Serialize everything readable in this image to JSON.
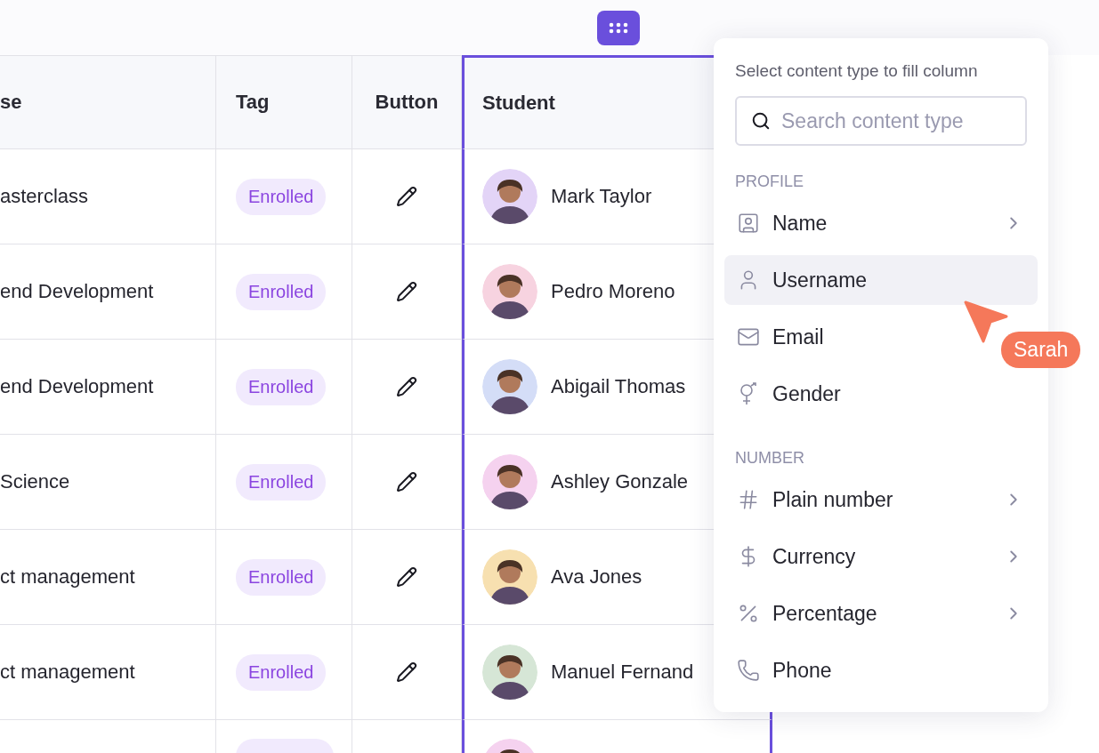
{
  "table": {
    "columns": [
      {
        "label": "se"
      },
      {
        "label": "Tag"
      },
      {
        "label": "Button"
      },
      {
        "label": "Student",
        "selected": true
      }
    ],
    "rows": [
      {
        "kind": "full",
        "course": "asterclass",
        "tag": "Enrolled",
        "student": "Mark Taylor",
        "color": "#e3d4f7"
      },
      {
        "kind": "full",
        "course": "end Development",
        "tag": "Enrolled",
        "student": "Pedro Moreno",
        "color": "#f7d3e0"
      },
      {
        "kind": "full",
        "course": "end Development",
        "tag": "Enrolled",
        "student": "Abigail Thomas",
        "color": "#d4ddf7"
      },
      {
        "kind": "full",
        "course": "Science",
        "tag": "Enrolled",
        "student": "Ashley Gonzale",
        "color": "#f5d2ef"
      },
      {
        "kind": "full",
        "course": "ct management",
        "tag": "Enrolled",
        "student": "Ava Jones",
        "color": "#f7e0b0"
      },
      {
        "kind": "full",
        "course": "ct management",
        "tag": "Enrolled",
        "student": "Manuel Fernand",
        "color": "#d6e6d6"
      },
      {
        "kind": "partial",
        "color": "#f5d2ef"
      }
    ]
  },
  "menu": {
    "title": "Select content type to fill column",
    "search": {
      "placeholder": "Search content type"
    },
    "sections": [
      {
        "label": "PROFILE",
        "items": [
          {
            "label": "Name",
            "has_submenu": true,
            "selected": false
          },
          {
            "label": "Username",
            "has_submenu": false,
            "selected": true
          },
          {
            "label": "Email",
            "has_submenu": false,
            "selected": false
          },
          {
            "label": "Gender",
            "has_submenu": false,
            "selected": false
          }
        ]
      },
      {
        "label": "NUMBER",
        "items": [
          {
            "label": "Plain number",
            "has_submenu": true,
            "selected": false
          },
          {
            "label": "Currency",
            "has_submenu": true,
            "selected": false
          },
          {
            "label": "Percentage",
            "has_submenu": true,
            "selected": false
          },
          {
            "label": "Phone",
            "has_submenu": false,
            "selected": false
          }
        ]
      }
    ]
  },
  "cursor": {
    "name": "Sarah"
  }
}
